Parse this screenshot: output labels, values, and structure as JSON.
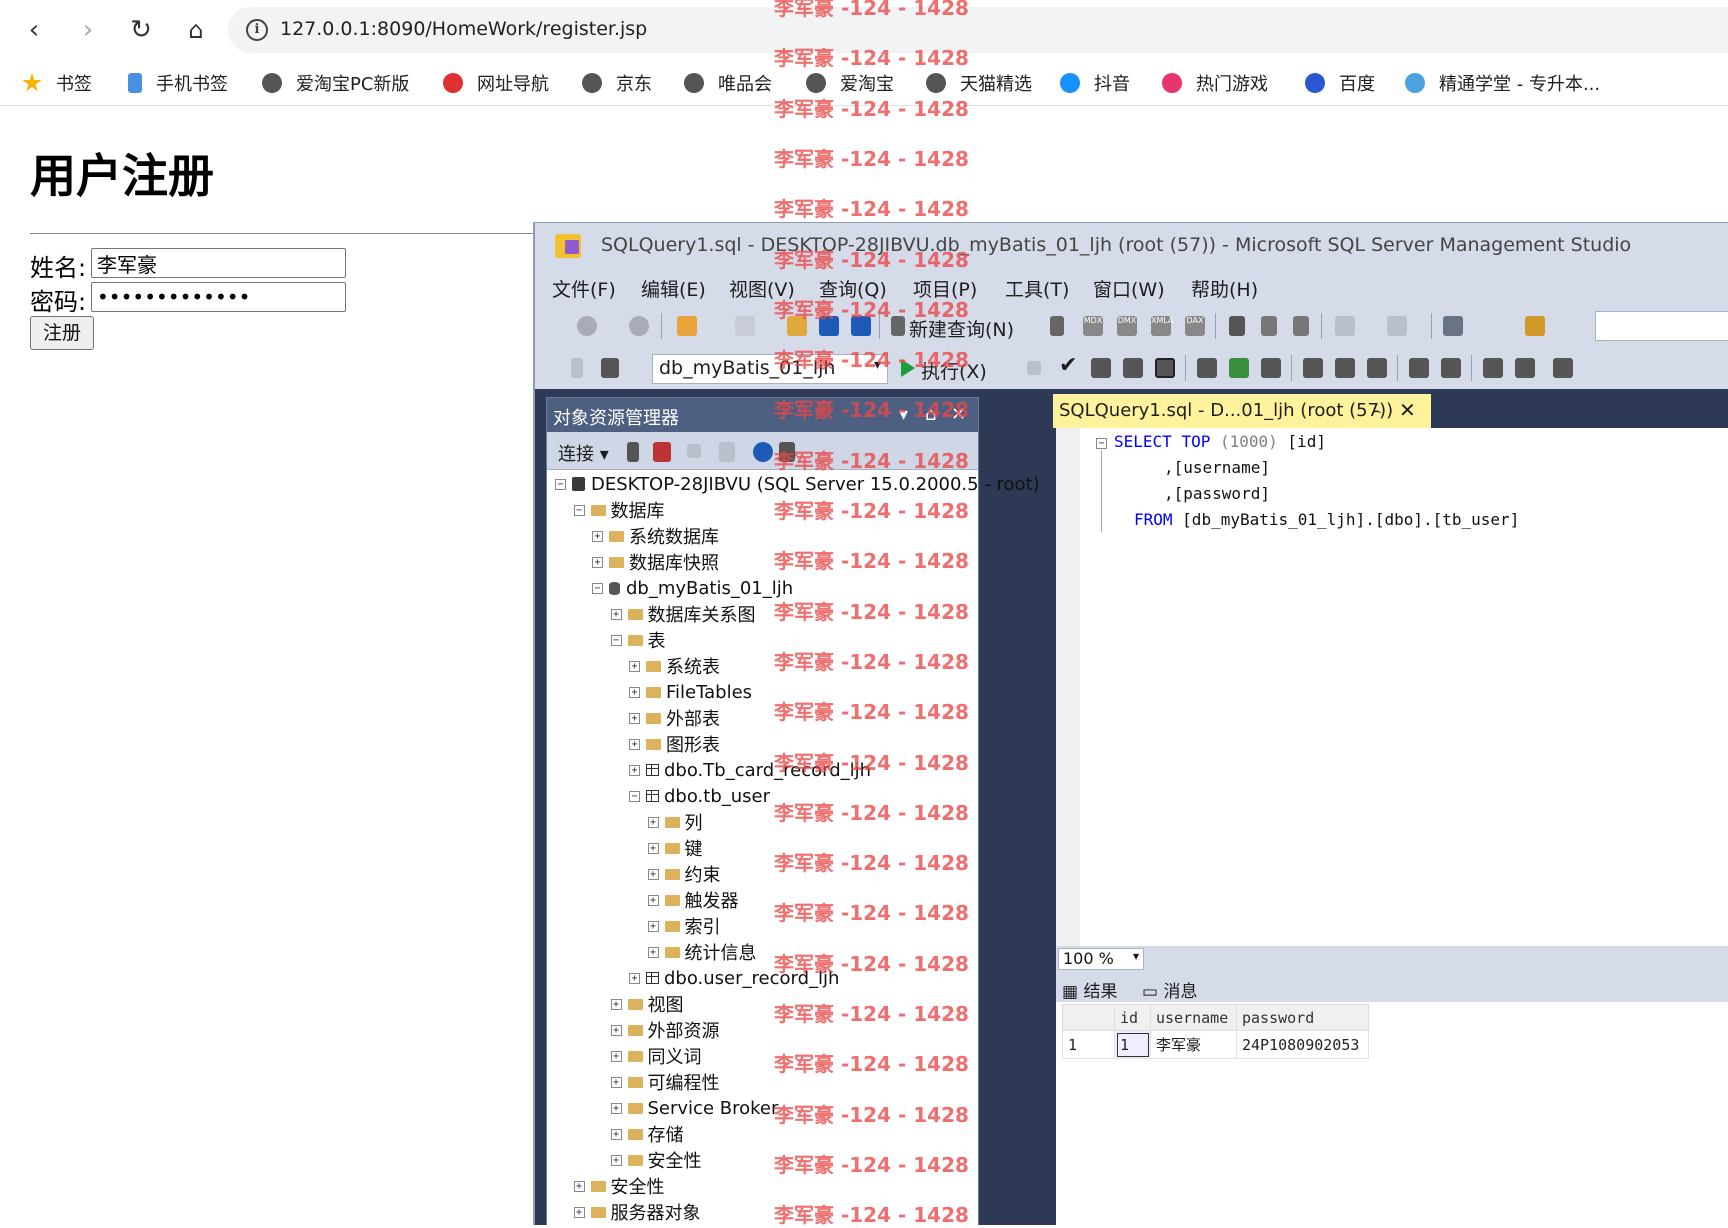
{
  "browser": {
    "url": "127.0.0.1:8090/HomeWork/register.jsp",
    "bookmarks": [
      {
        "label": "书签",
        "color": "#f7b500"
      },
      {
        "label": "手机书签",
        "color": "#4a90e2"
      },
      {
        "label": "爱淘宝PC新版",
        "color": "#555555"
      },
      {
        "label": "网址导航",
        "color": "#e03131"
      },
      {
        "label": "京东",
        "color": "#555555"
      },
      {
        "label": "唯品会",
        "color": "#555555"
      },
      {
        "label": "爱淘宝",
        "color": "#555555"
      },
      {
        "label": "天猫精选",
        "color": "#555555"
      },
      {
        "label": "抖音",
        "color": "#1890ff"
      },
      {
        "label": "热门游戏",
        "color": "#e8336d"
      },
      {
        "label": "百度",
        "color": "#2c57d3"
      },
      {
        "label": "精通学堂 - 专升本...",
        "color": "#4aa3df"
      }
    ]
  },
  "page": {
    "title": "用户注册",
    "name_label": "姓名:",
    "name_value": "李军豪",
    "password_label": "密码:",
    "password_value": "•••••••••••••",
    "submit_label": "注册"
  },
  "ssms": {
    "title": "SQLQuery1.sql - DESKTOP-28JIBVU.db_myBatis_01_ljh (root (57)) - Microsoft SQL Server Management Studio",
    "menu": [
      "文件(F)",
      "编辑(E)",
      "视图(V)",
      "查询(Q)",
      "项目(P)",
      "工具(T)",
      "窗口(W)",
      "帮助(H)"
    ],
    "new_query_label": "新建查询(N)",
    "toolbar_codes": [
      "MDX",
      "DMX",
      "XMLA",
      "DAX"
    ],
    "database_select": "db_myBatis_01_ljh",
    "execute_label": "执行(X)",
    "object_explorer": {
      "title": "对象资源管理器",
      "connect_label": "连接",
      "tree": [
        {
          "label": "DESKTOP-28JIBVU (SQL Server 15.0.2000.5 - root)",
          "level": 0,
          "exp": "−",
          "icon": "server"
        },
        {
          "label": "数据库",
          "level": 1,
          "exp": "−",
          "icon": "folder"
        },
        {
          "label": "系统数据库",
          "level": 2,
          "exp": "+",
          "icon": "folder"
        },
        {
          "label": "数据库快照",
          "level": 2,
          "exp": "+",
          "icon": "folder"
        },
        {
          "label": "db_myBatis_01_ljh",
          "level": 2,
          "exp": "−",
          "icon": "db"
        },
        {
          "label": "数据库关系图",
          "level": 3,
          "exp": "+",
          "icon": "folder"
        },
        {
          "label": "表",
          "level": 3,
          "exp": "−",
          "icon": "folder"
        },
        {
          "label": "系统表",
          "level": 4,
          "exp": "+",
          "icon": "folder"
        },
        {
          "label": "FileTables",
          "level": 4,
          "exp": "+",
          "icon": "folder"
        },
        {
          "label": "外部表",
          "level": 4,
          "exp": "+",
          "icon": "folder"
        },
        {
          "label": "图形表",
          "level": 4,
          "exp": "+",
          "icon": "folder"
        },
        {
          "label": "dbo.Tb_card_record_ljh",
          "level": 4,
          "exp": "+",
          "icon": "table"
        },
        {
          "label": "dbo.tb_user",
          "level": 4,
          "exp": "−",
          "icon": "table"
        },
        {
          "label": "列",
          "level": 5,
          "exp": "+",
          "icon": "folder"
        },
        {
          "label": "键",
          "level": 5,
          "exp": "+",
          "icon": "folder"
        },
        {
          "label": "约束",
          "level": 5,
          "exp": "+",
          "icon": "folder"
        },
        {
          "label": "触发器",
          "level": 5,
          "exp": "+",
          "icon": "folder"
        },
        {
          "label": "索引",
          "level": 5,
          "exp": "+",
          "icon": "folder"
        },
        {
          "label": "统计信息",
          "level": 5,
          "exp": "+",
          "icon": "folder"
        },
        {
          "label": "dbo.user_record_ljh",
          "level": 4,
          "exp": "+",
          "icon": "table"
        },
        {
          "label": "视图",
          "level": 3,
          "exp": "+",
          "icon": "folder"
        },
        {
          "label": "外部资源",
          "level": 3,
          "exp": "+",
          "icon": "folder"
        },
        {
          "label": "同义词",
          "level": 3,
          "exp": "+",
          "icon": "folder"
        },
        {
          "label": "可编程性",
          "level": 3,
          "exp": "+",
          "icon": "folder"
        },
        {
          "label": "Service Broker",
          "level": 3,
          "exp": "+",
          "icon": "folder"
        },
        {
          "label": "存储",
          "level": 3,
          "exp": "+",
          "icon": "folder"
        },
        {
          "label": "安全性",
          "level": 3,
          "exp": "+",
          "icon": "folder"
        },
        {
          "label": "安全性",
          "level": 1,
          "exp": "+",
          "icon": "folder"
        },
        {
          "label": "服务器对象",
          "level": 1,
          "exp": "+",
          "icon": "folder"
        }
      ]
    },
    "query_tab": "SQLQuery1.sql - D...01_ljh (root (57))",
    "sql": {
      "line1_kw1": "SELECT",
      "line1_kw2": "TOP",
      "line1_rest": "(1000)",
      "line1_col": "[id]",
      "line2": ",[username]",
      "line3": ",[password]",
      "line4_kw": "FROM",
      "line4_rest": "[db_myBatis_01_ljh].[dbo].[tb_user]"
    },
    "zoom": "100 %",
    "results_tab": "结果",
    "messages_tab": "消息",
    "grid": {
      "columns": [
        "",
        "id",
        "username",
        "password"
      ],
      "rows": [
        [
          "1",
          "1",
          "李军豪",
          "24P1080902053"
        ]
      ]
    }
  },
  "watermark": "李军豪 -124 - 1428",
  "colors": {
    "accent": "#fff29d",
    "panel_header": "#4d6082",
    "sql_keyword": "#0000ff"
  }
}
